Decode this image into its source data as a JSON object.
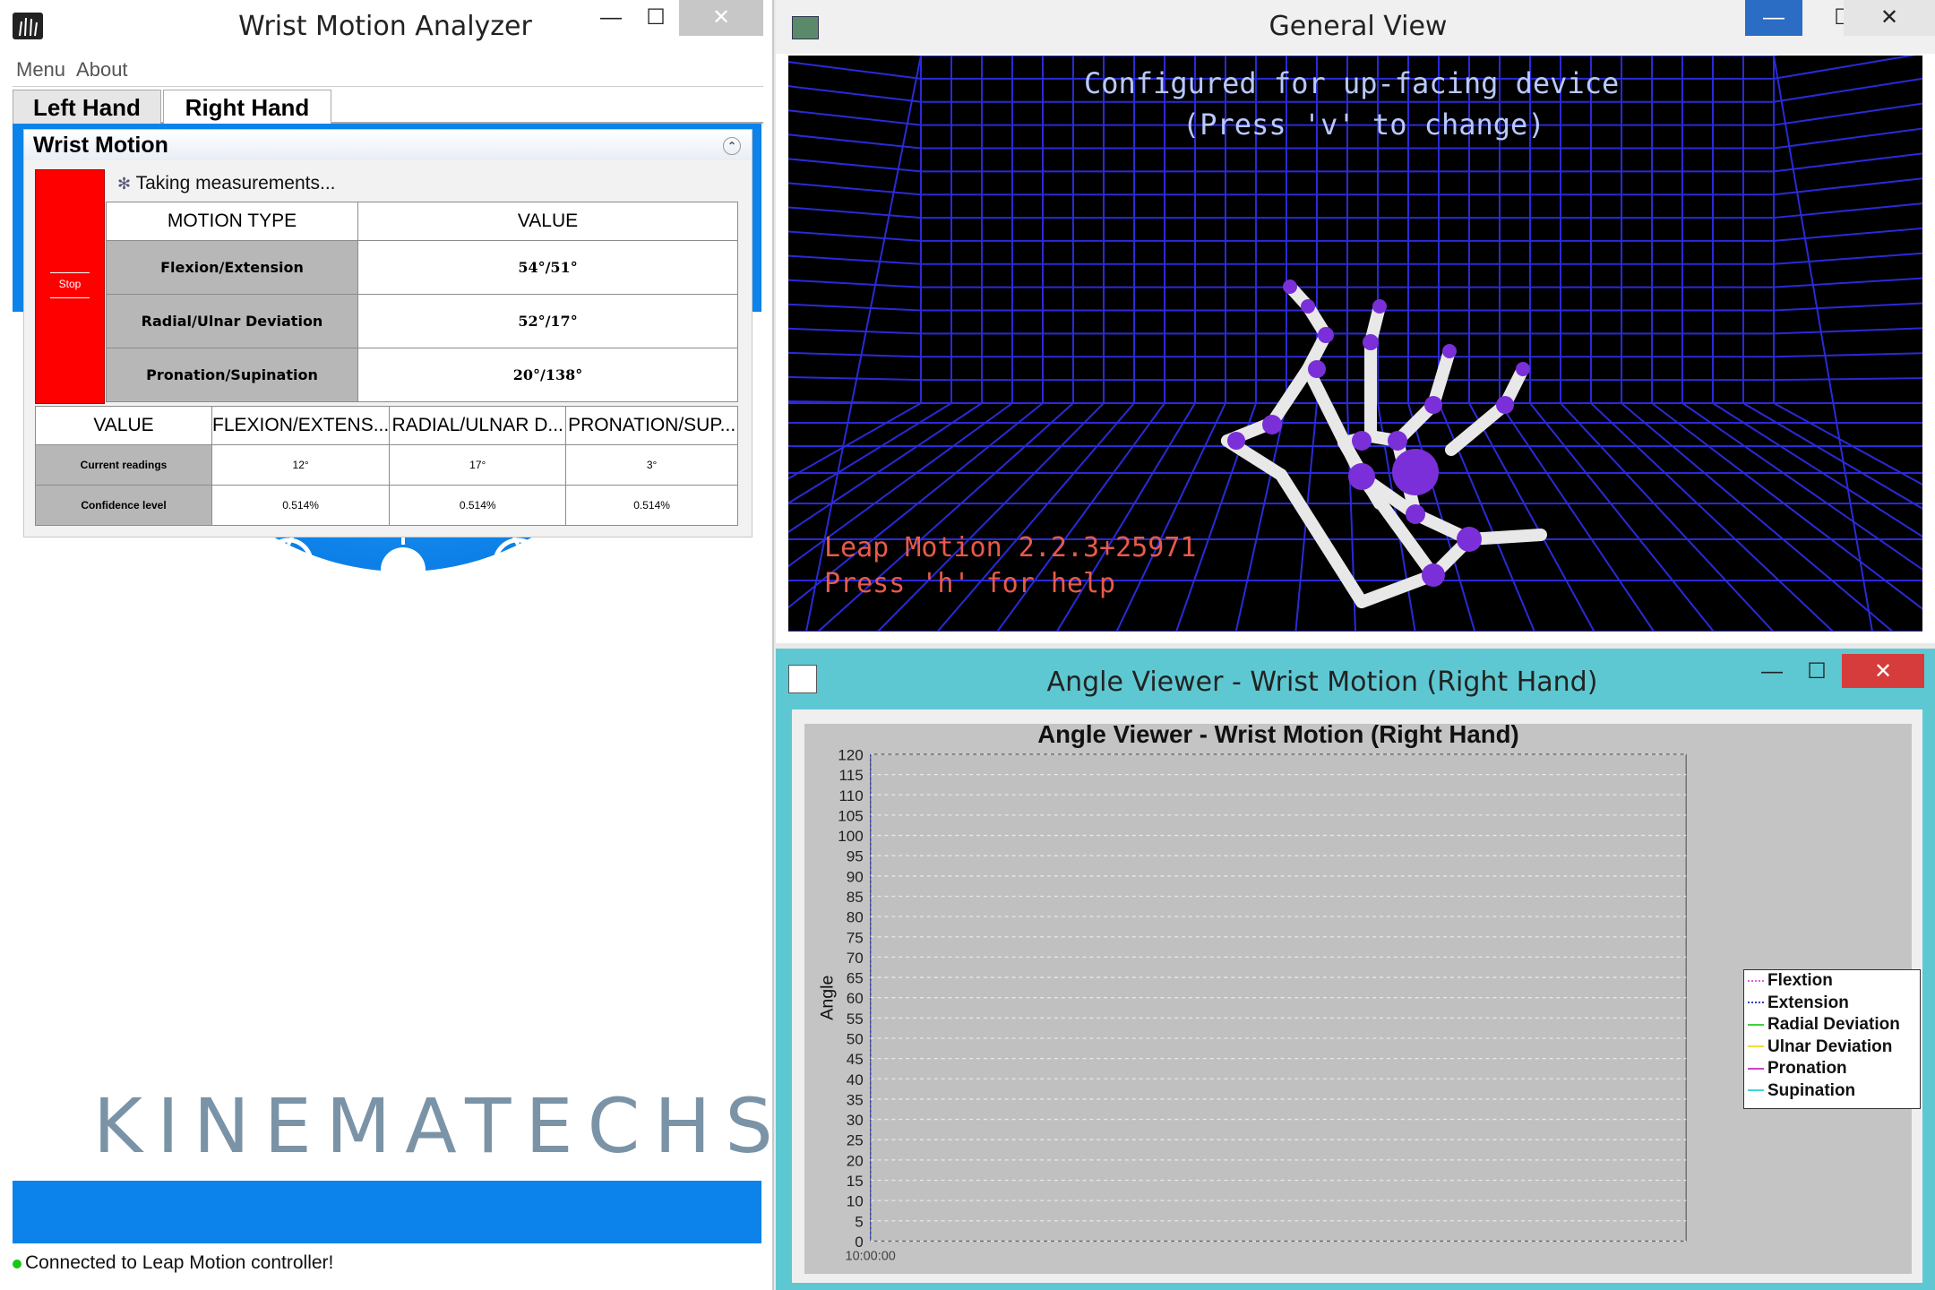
{
  "analyzer": {
    "title": "Wrist Motion Analyzer",
    "min": "—",
    "max": "☐",
    "close": "✕",
    "menu": [
      "Menu",
      "About"
    ],
    "tabs": [
      "Left Hand",
      "Right Hand"
    ],
    "active_tab": "Right Hand",
    "panel_title": "Wrist Motion",
    "stop_label": "Stop",
    "status_msg": "Taking measurements...",
    "table1": {
      "headers": [
        "MOTION TYPE",
        "VALUE"
      ],
      "rows": [
        [
          "Flexion/Extension",
          "54°/51°"
        ],
        [
          "Radial/Ulnar Deviation",
          "52°/17°"
        ],
        [
          "Pronation/Supination",
          "20°/138°"
        ]
      ]
    },
    "table2": {
      "headers": [
        "VALUE",
        "FLEXION/EXTENS...",
        "RADIAL/ULNAR D...",
        "PRONATION/SUP..."
      ],
      "rows": [
        [
          "Current readings",
          "12°",
          "17°",
          "3°"
        ],
        [
          "Confidence level",
          "0.514%",
          "0.514%",
          "0.514%"
        ]
      ]
    },
    "logo_text": "KINEMATECHS",
    "connection": "Connected to Leap Motion controller!",
    "colors": {
      "accent": "#0b83ea",
      "stop": "#ff0000",
      "connected": "#14c814"
    }
  },
  "general_view": {
    "title": "General View",
    "overlay_line1": "Configured for up-facing device",
    "overlay_line2": "(Press 'v' to change)",
    "version": "Leap Motion 2.2.3+25971",
    "help": "Press 'h' for help",
    "min": "—",
    "max": "☐",
    "close": "✕"
  },
  "angle_viewer": {
    "title": "Angle Viewer - Wrist Motion (Right Hand)",
    "min": "—",
    "max": "☐",
    "close": "✕",
    "legend": [
      {
        "name": "Flextion",
        "color": "#e060e0",
        "style": "dotted"
      },
      {
        "name": "Extension",
        "color": "#3040c0",
        "style": "dotted"
      },
      {
        "name": "Radial Deviation",
        "color": "#40d040",
        "style": "solid"
      },
      {
        "name": "Ulnar Deviation",
        "color": "#e8e040",
        "style": "solid"
      },
      {
        "name": "Pronation",
        "color": "#d040d0",
        "style": "solid"
      },
      {
        "name": "Supination",
        "color": "#40d8d8",
        "style": "solid"
      }
    ]
  },
  "chart_data": {
    "type": "line",
    "title": "Angle Viewer - Wrist Motion (Right Hand)",
    "xlabel": "",
    "ylabel": "Angle",
    "ylim": [
      0,
      120
    ],
    "yticks": [
      0,
      5,
      10,
      15,
      20,
      25,
      30,
      35,
      40,
      45,
      50,
      55,
      60,
      65,
      70,
      75,
      80,
      85,
      90,
      95,
      100,
      105,
      110,
      115,
      120
    ],
    "x_first_tick": "10:00:00",
    "grid": true,
    "legend_position": "right",
    "series": [
      {
        "name": "Flextion",
        "values": []
      },
      {
        "name": "Extension",
        "values": []
      },
      {
        "name": "Radial Deviation",
        "values": []
      },
      {
        "name": "Ulnar Deviation",
        "values": []
      },
      {
        "name": "Pronation",
        "values": []
      },
      {
        "name": "Supination",
        "values": []
      }
    ]
  }
}
